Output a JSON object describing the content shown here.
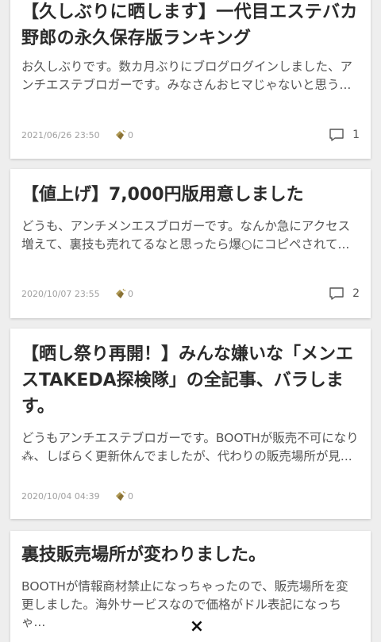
{
  "posts": [
    {
      "title": "【久しぶりに晒します】一代目エステバカ野郎の永久保存版ランキング",
      "excerpt": "お久しぶりです。数カ月ぶりにブログログインしました、アンチエステブロガーです。みなさんおヒマじゃないと思う...",
      "date": "2021/06/26 23:50",
      "claps": "0",
      "comments": "1"
    },
    {
      "title": "【値上げ】7,000円版用意しました",
      "excerpt": "どうも、アンチメンエスブロガーです。なんか急にアクセス増えて、裏技も売れてるなと思ったら爆○にコピペされて...",
      "date": "2020/10/07 23:55",
      "claps": "0",
      "comments": "2"
    },
    {
      "title": "【晒し祭り再開！】みんな嫌いな「メンエスTAKEDA探検隊」の全記事、バラします。",
      "excerpt": "どうもアンチエステブロガーです。BOOTHが販売不可になり⁂、しばらく更新休んでましたが、代わりの販売場所が見...",
      "date": "2020/10/04 04:39",
      "claps": "0"
    },
    {
      "title": "裏技販売場所が変わりました。",
      "excerpt": "BOOTHが情報商材禁止になっちゃったので、販売場所を変更しました。海外サービスなので価格がドル表記になっちゃ..."
    }
  ],
  "overlay": {
    "close_label": "×"
  },
  "icons": {
    "clap": "clap-hands-icon",
    "comment": "comment-bubble-icon",
    "close": "close-icon"
  },
  "colors": {
    "background": "#eeeeee",
    "card": "#ffffff",
    "clap": "#a08a4a",
    "meta": "#a0a0a0"
  }
}
